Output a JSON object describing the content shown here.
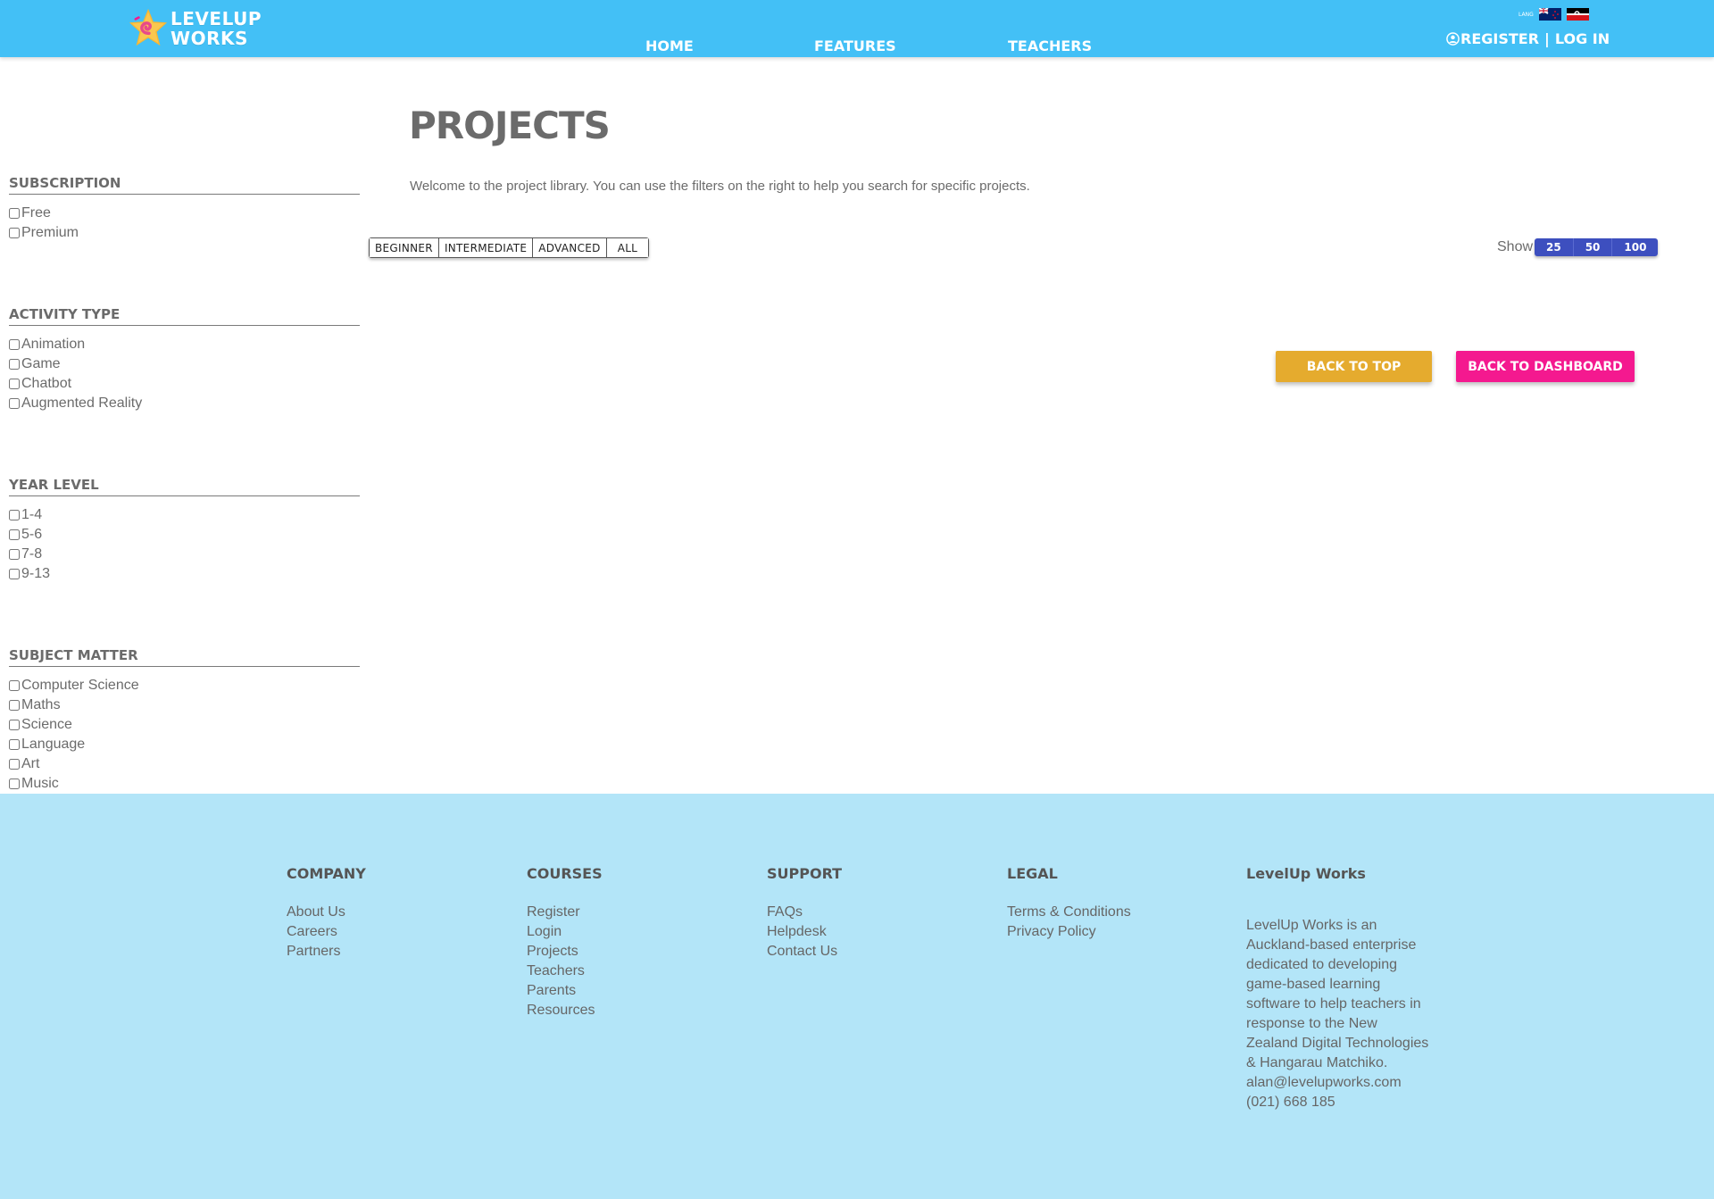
{
  "brand": {
    "line1": "LEVELUP",
    "line2": "WORKS"
  },
  "nav": [
    {
      "label": "HOME"
    },
    {
      "label": "FEATURES"
    },
    {
      "label": "TEACHERS"
    }
  ],
  "lang": {
    "label": "LANG",
    "flags": [
      "new-zealand-flag-icon",
      "tino-rangatiratanga-flag-icon"
    ]
  },
  "auth": {
    "register": "REGISTER",
    "separator": "|",
    "login": "LOG IN"
  },
  "filters": {
    "subscription": {
      "title": "SUBSCRIPTION",
      "options": [
        "Free",
        "Premium"
      ]
    },
    "activity": {
      "title": "ACTIVITY TYPE",
      "options": [
        "Animation",
        "Game",
        "Chatbot",
        "Augmented Reality"
      ]
    },
    "year": {
      "title": "YEAR LEVEL",
      "options": [
        "1-4",
        "5-6",
        "7-8",
        "9-13"
      ]
    },
    "subject": {
      "title": "SUBJECT MATTER",
      "options": [
        "Computer Science",
        "Maths",
        "Science",
        "Language",
        "Art",
        "Music"
      ]
    }
  },
  "main": {
    "title": "PROJECTS",
    "intro": "Welcome to the project library. You can use the filters on the right to help you search for specific projects.",
    "levels": [
      "BEGINNER",
      "INTERMEDIATE",
      "ADVANCED",
      "ALL"
    ],
    "show_label": "Show",
    "show_options": [
      "25",
      "50",
      "100"
    ],
    "back_to_top": "BACK TO TOP",
    "back_to_dashboard": "BACK TO DASHBOARD"
  },
  "footer": {
    "company": {
      "title": "COMPANY",
      "links": [
        "About Us",
        "Careers",
        "Partners"
      ]
    },
    "courses": {
      "title": "COURSES",
      "links": [
        "Register",
        "Login",
        "Projects",
        "Teachers",
        "Parents",
        "Resources"
      ]
    },
    "support": {
      "title": "SUPPORT",
      "links": [
        "FAQs",
        "Helpdesk",
        "Contact Us"
      ]
    },
    "legal": {
      "title": "LEGAL",
      "links": [
        "Terms & Conditions",
        "Privacy Policy"
      ]
    },
    "about": {
      "title": "LevelUp Works",
      "text": "LevelUp Works is an Auckland-based enterprise dedicated to developing game-based learning software to help teachers in response to the New Zealand Digital Technologies & Hangarau Matchiko.",
      "email": "alan@levelupworks.com",
      "phone": "(021) 668 185"
    }
  },
  "colors": {
    "header": "#43c0f6",
    "footer": "#b3e5f8",
    "show_button": "#3d4fbf",
    "back_to_top": "#e5ab2e",
    "back_to_dashboard": "#f4198f"
  }
}
